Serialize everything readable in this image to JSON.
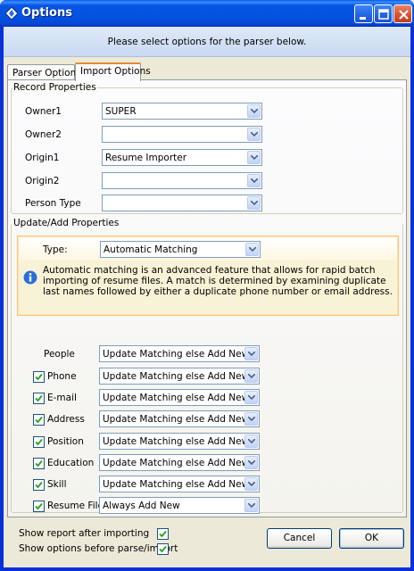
{
  "window": {
    "title": "Options"
  },
  "header": {
    "text": "Please select options for the parser below."
  },
  "tabs": [
    {
      "label": "Parser Options"
    },
    {
      "label": "Import Options"
    }
  ],
  "record_properties": {
    "legend": "Record Properties",
    "rows": [
      {
        "label": "Owner1",
        "value": "SUPER"
      },
      {
        "label": "Owner2",
        "value": ""
      },
      {
        "label": "Origin1",
        "value": "Resume Importer"
      },
      {
        "label": "Origin2",
        "value": ""
      },
      {
        "label": "Person Type",
        "value": ""
      }
    ]
  },
  "update_properties": {
    "legend": "Update/Add Properties",
    "type_label": "Type:",
    "type_value": "Automatic Matching",
    "info": "Automatic matching is an advanced feature that allows for rapid batch importing of resume files.  A match is determined by examining duplicate last names followed by either a duplicate phone number or email address.",
    "rows": [
      {
        "label": "People",
        "value": "Update Matching else Add New",
        "checkbox": false
      },
      {
        "label": "Phone",
        "value": "Update Matching else Add New",
        "checkbox": true,
        "checked": true
      },
      {
        "label": "E-mail",
        "value": "Update Matching else Add New",
        "checkbox": true,
        "checked": true
      },
      {
        "label": "Address",
        "value": "Update Matching else Add New",
        "checkbox": true,
        "checked": true
      },
      {
        "label": "Position",
        "value": "Update Matching else Add New",
        "checkbox": true,
        "checked": true
      },
      {
        "label": "Education",
        "value": "Update Matching else Add New",
        "checkbox": true,
        "checked": true
      },
      {
        "label": "Skill",
        "value": "Update Matching else Add New",
        "checkbox": true,
        "checked": true
      },
      {
        "label": "Resume File",
        "value": "Always Add New",
        "checkbox": true,
        "checked": true
      }
    ]
  },
  "footer": {
    "show_report_label": "Show report after importing",
    "show_report_checked": true,
    "show_options_label": "Show options before parse/import",
    "show_options_checked": true,
    "cancel_label": "Cancel",
    "ok_label": "OK"
  },
  "icons": {
    "title": "diamond-arrows-icon",
    "info": "info-icon",
    "dropdown": "chevron-down-icon"
  },
  "colors": {
    "titlebar": "#0452e1",
    "header_panel": "#dfe9f8",
    "tab_accent": "#e68b2c",
    "info_panel": "#f8f2d6",
    "info_icon": "#2e6fd6"
  }
}
